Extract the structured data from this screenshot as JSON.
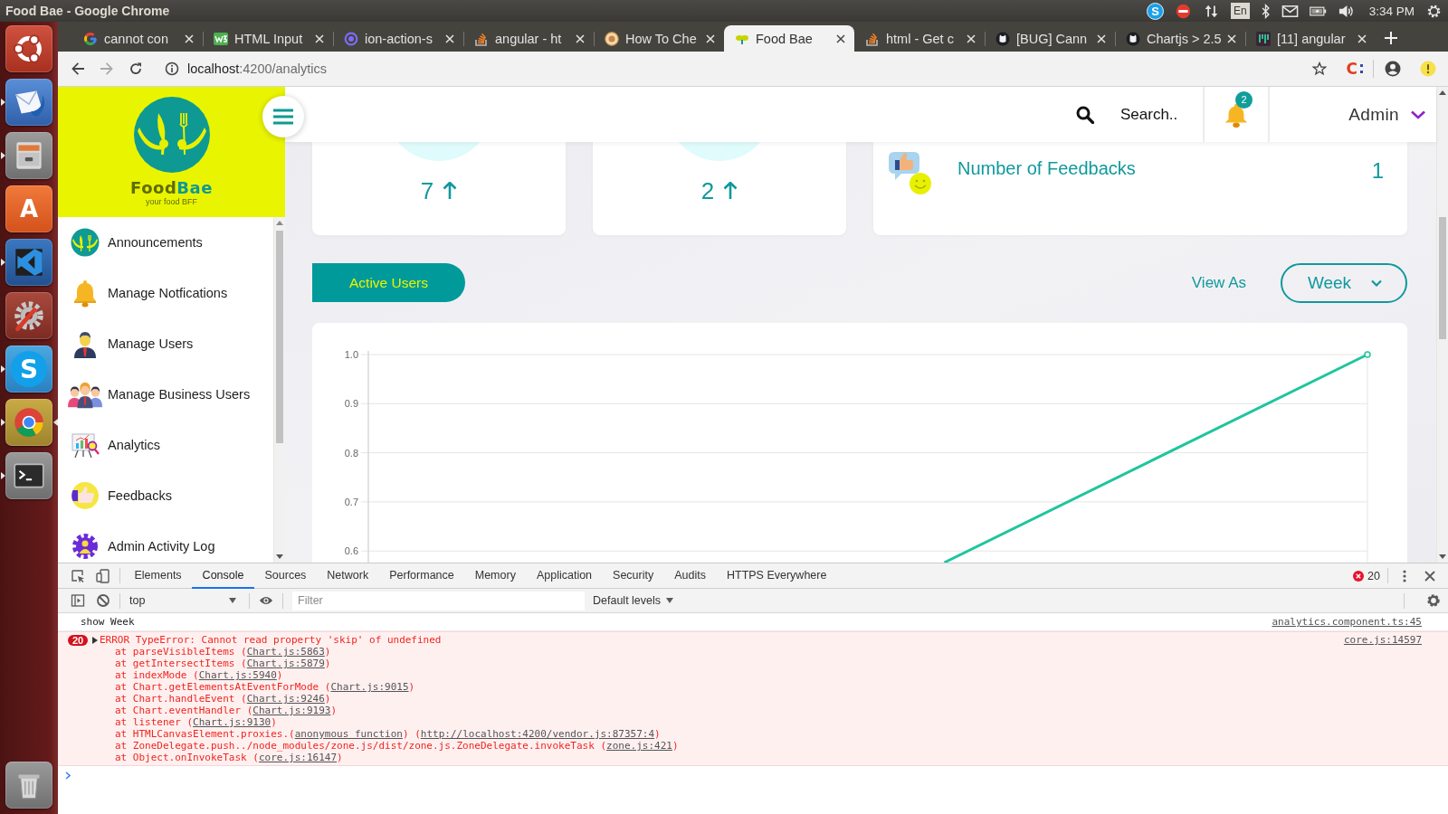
{
  "desktop_panel": {
    "window_title": "Food Bae - Google Chrome",
    "skype_glyph": "S",
    "keyboard_layout": "En",
    "clock": "3:34 PM"
  },
  "launcher": [
    {
      "kind": "ubuntu",
      "running": false,
      "focused": false
    },
    {
      "kind": "mail",
      "running": true,
      "focused": false
    },
    {
      "kind": "files",
      "running": true,
      "focused": false
    },
    {
      "kind": "software",
      "glyph": "A",
      "running": false,
      "focused": false
    },
    {
      "kind": "editor",
      "running": true,
      "focused": false
    },
    {
      "kind": "settings",
      "running": false,
      "focused": false
    },
    {
      "kind": "skype",
      "glyph": "S",
      "running": true,
      "focused": false
    },
    {
      "kind": "browser",
      "running": true,
      "focused": true
    },
    {
      "kind": "terminal",
      "running": true,
      "focused": false
    },
    {
      "kind": "trash",
      "running": false,
      "focused": false
    }
  ],
  "browser": {
    "tabs": [
      {
        "title": "cannot con",
        "kind": "google",
        "selected": false
      },
      {
        "title": "HTML Input",
        "kind": "w3",
        "selected": false
      },
      {
        "title": "ion-action-s",
        "kind": "ionic",
        "selected": false
      },
      {
        "title": "angular - ht",
        "kind": "stack",
        "selected": false
      },
      {
        "title": "How To Che",
        "kind": "site",
        "selected": false
      },
      {
        "title": "Food Bae",
        "kind": "foodbae",
        "selected": true
      },
      {
        "title": "html - Get c",
        "kind": "stack",
        "selected": false
      },
      {
        "title": "[BUG] Cann",
        "kind": "github",
        "selected": false
      },
      {
        "title": "Chartjs > 2.5",
        "kind": "github",
        "selected": false
      },
      {
        "title": "[11] angular",
        "kind": "bars",
        "selected": false
      }
    ],
    "address": {
      "host": "localhost",
      "path": ":4200/analytics"
    },
    "extension_glyph": "C"
  },
  "app": {
    "sidebar": {
      "wordmark": [
        "Food",
        "Bae"
      ],
      "tagline": "your food BFF",
      "items": [
        {
          "label": "Announcements",
          "kind": "announce"
        },
        {
          "label": "Manage Notfications",
          "kind": "bell"
        },
        {
          "label": "Manage Users",
          "kind": "user"
        },
        {
          "label": "Manage Business Users",
          "kind": "group"
        },
        {
          "label": "Analytics",
          "kind": "analytics"
        },
        {
          "label": "Feedbacks",
          "kind": "feedback"
        },
        {
          "label": "Admin Activity Log",
          "kind": "activity"
        }
      ]
    },
    "header": {
      "search_placeholder": "Search..",
      "notification_count": "2",
      "user_name": "Admin"
    },
    "stat_cards": [
      {
        "kind": "trend",
        "value": "7",
        "rising": true
      },
      {
        "kind": "trend",
        "value": "2",
        "rising": true
      },
      {
        "kind": "metric",
        "label": "Number of Feedbacks",
        "value": "1"
      }
    ],
    "chart_controls": {
      "series_button": "Active Users",
      "view_as_label": "View As",
      "period": "Week"
    },
    "chart": {
      "y_axis_labels": [
        "1.0",
        "0.9",
        "0.8",
        "0.7",
        "0.6"
      ]
    }
  },
  "devtools": {
    "tabs": [
      {
        "label": "Elements",
        "selected": false
      },
      {
        "label": "Console",
        "selected": true
      },
      {
        "label": "Sources",
        "selected": false
      },
      {
        "label": "Network",
        "selected": false
      },
      {
        "label": "Performance",
        "selected": false
      },
      {
        "label": "Memory",
        "selected": false
      },
      {
        "label": "Application",
        "selected": false
      },
      {
        "label": "Security",
        "selected": false
      },
      {
        "label": "Audits",
        "selected": false
      },
      {
        "label": "HTTPS Everywhere",
        "selected": false
      }
    ],
    "error_count": "20",
    "context": "top",
    "filter_placeholder": "Filter",
    "levels": "Default levels",
    "messages": [
      {
        "kind": "log",
        "text": "show Week",
        "source": "analytics.component.ts:45"
      },
      {
        "kind": "error",
        "count": "20",
        "expanded": false,
        "text": "ERROR TypeError: Cannot read property 'skip' of undefined",
        "source": "core.js:14597",
        "stack": [
          [
            "at parseVisibleItems (",
            "Chart.js:5863",
            ")"
          ],
          [
            "at getIntersectItems (",
            "Chart.js:5879",
            ")"
          ],
          [
            "at indexMode (",
            "Chart.js:5940",
            ")"
          ],
          [
            "at Chart.getElementsAtEventForMode (",
            "Chart.js:9015",
            ")"
          ],
          [
            "at Chart.handleEvent (",
            "Chart.js:9246",
            ")"
          ],
          [
            "at Chart.eventHandler (",
            "Chart.js:9193",
            ")"
          ],
          [
            "at listener (",
            "Chart.js:9130",
            ")"
          ],
          [
            "at HTMLCanvasElement.proxies.(",
            "anonymous function",
            ") (",
            "http://localhost:4200/vendor.js:87357:4",
            ")"
          ],
          [
            "at ZoneDelegate.push../node_modules/zone.js/dist/zone.js.ZoneDelegate.invokeTask (",
            "zone.js:421",
            ")"
          ],
          [
            "at Object.onInvokeTask (",
            "core.js:16147",
            ")"
          ]
        ]
      }
    ]
  }
}
